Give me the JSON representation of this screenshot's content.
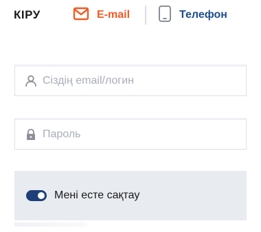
{
  "header": {
    "title": "КІРУ",
    "tabs": [
      {
        "label": "E-mail",
        "icon": "envelope-icon",
        "color": "#f15a24",
        "active": true
      },
      {
        "label": "Телефон",
        "icon": "phone-icon",
        "color": "#1f4e8c",
        "active": false
      }
    ]
  },
  "form": {
    "login": {
      "placeholder": "Сіздің email/логин",
      "value": "",
      "icon": "user-icon"
    },
    "password": {
      "placeholder": "Пароль",
      "value": "",
      "icon": "lock-icon"
    }
  },
  "remember": {
    "label": "Мені есте сақтау",
    "checked": true,
    "accent": "#1f3f7a"
  }
}
